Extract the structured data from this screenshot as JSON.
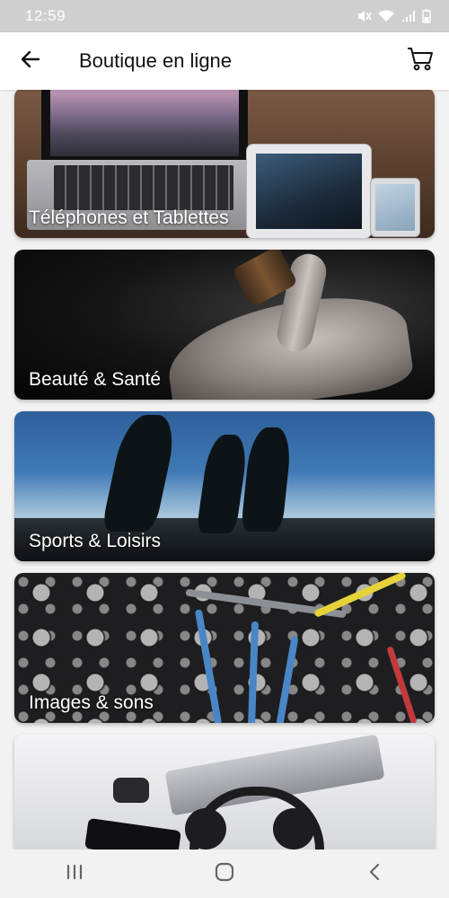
{
  "status_bar": {
    "time": "12:59",
    "icons": [
      "mute-icon",
      "wifi-icon",
      "signal-icon",
      "battery-icon"
    ]
  },
  "app_bar": {
    "title": "Boutique en ligne",
    "back_icon": "arrow-left-icon",
    "cart_icon": "cart-icon"
  },
  "categories": [
    {
      "label": "Téléphones et Tablettes"
    },
    {
      "label": "Beauté & Santé"
    },
    {
      "label": "Sports & Loisirs"
    },
    {
      "label": "Images & sons"
    },
    {
      "label": ""
    }
  ],
  "nav_bar": {
    "icons": [
      "recent-apps-icon",
      "home-icon",
      "back-icon"
    ]
  },
  "colors": {
    "status_bar_bg": "#cfcfcf",
    "app_bar_bg": "#ffffff",
    "page_bg": "#f2f2f2",
    "card_label": "#ffffff"
  }
}
